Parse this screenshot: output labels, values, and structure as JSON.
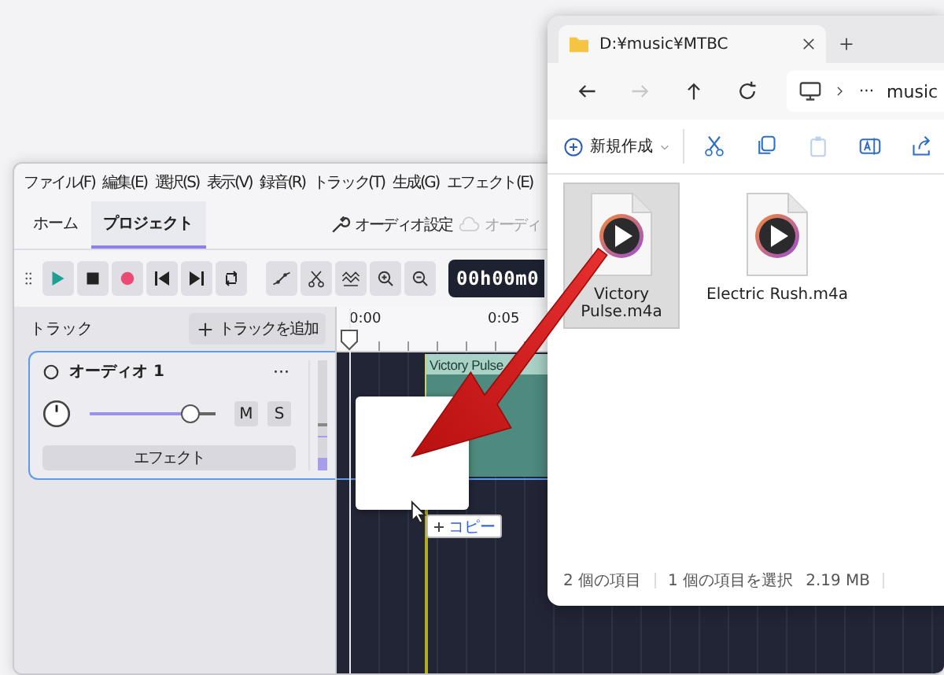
{
  "editor": {
    "menu": [
      "ファイル(F)",
      "編集(E)",
      "選択(S)",
      "表示(V)",
      "録音(R)",
      "トラック(T)",
      "生成(G)",
      "エフェクト(E)"
    ],
    "tabs": [
      {
        "label": "ホーム",
        "selected": false
      },
      {
        "label": "プロジェクト",
        "selected": true
      }
    ],
    "ribbon_actions": [
      {
        "label": "オーディオ設定",
        "disabled": false
      },
      {
        "label": "オーディ",
        "disabled": true
      }
    ],
    "time_display": "00h00m0",
    "tracks_label": "トラック",
    "add_track_button": "トラックを追加",
    "ruler": [
      "0:00",
      "0:05"
    ],
    "track": {
      "name": "オーディオ 1",
      "menu": "···",
      "volume": {
        "level": 0.8
      },
      "mute": "M",
      "solo": "S",
      "effects_button": "エフェクト"
    },
    "clip": {
      "title": "Victory Pulse"
    },
    "drop_tooltip": "コピー"
  },
  "explorer": {
    "tab_title": "D:¥music¥MTBC",
    "address_dots": "···",
    "address": "music",
    "new_button": "新規作成",
    "files": [
      {
        "name": "Victory Pulse.m4a",
        "selected": true
      },
      {
        "name": "Electric Rush.m4a",
        "selected": false
      }
    ],
    "status": {
      "item_count": "2 個の項目",
      "selection": "1 個の項目を選択",
      "size": "2.19 MB"
    }
  }
}
